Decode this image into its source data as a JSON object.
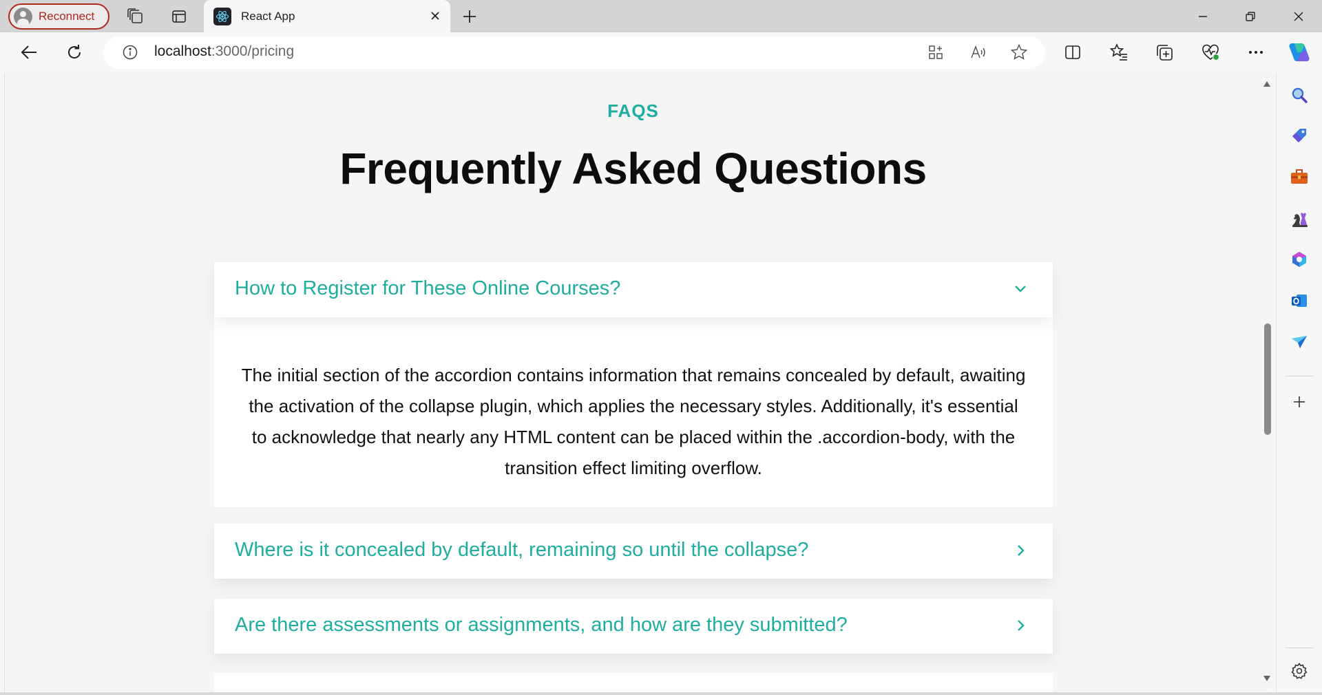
{
  "browser": {
    "profile_label": "Reconnect",
    "tab_title": "React App",
    "url_host": "localhost",
    "url_path": ":3000/pricing",
    "accent_profile": "#b3261e"
  },
  "page": {
    "eyebrow": "FAQS",
    "heading": "Frequently Asked Questions",
    "accent": "#1fada0",
    "faqs": [
      {
        "question": "How to Register for These Online Courses?",
        "expanded": true,
        "answer": "The initial section of the accordion contains information that remains concealed by default, awaiting the activation of the collapse plugin, which applies the necessary styles. Additionally, it's essential to acknowledge that nearly any HTML content can be placed within the .accordion-body, with the transition effect limiting overflow."
      },
      {
        "question": "Where is it concealed by default, remaining so until the collapse?",
        "expanded": false
      },
      {
        "question": "Are there assessments or assignments, and how are they submitted?",
        "expanded": false
      }
    ]
  },
  "icons": {
    "sidebar": [
      "search-icon",
      "tag-icon",
      "toolbox-icon",
      "chess-icon",
      "office-icon",
      "outlook-icon",
      "send-icon",
      "add-icon",
      "settings-icon"
    ]
  }
}
